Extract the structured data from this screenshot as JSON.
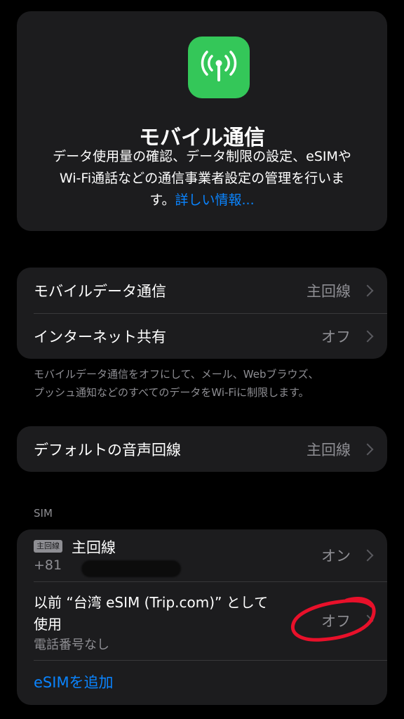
{
  "header": {
    "icon": "antenna-icon",
    "icon_color": "#34c759",
    "title": "モバイル通信",
    "description_line1": "データ使用量の確認、データ制限の設定、eSIMや",
    "description_line2": "Wi-Fi通話などの通信事業者設定の管理を行いま",
    "description_line3": "す。",
    "link": "詳しい情報..."
  },
  "settings": {
    "mobile_data": {
      "label": "モバイルデータ通信",
      "value": "主回線"
    },
    "hotspot": {
      "label": "インターネット共有",
      "value": "オフ"
    },
    "note_line1": "モバイルデータ通信をオフにして、メール、Webブラウズ、",
    "note_line2": "プッシュ通知などのすべてのデータをWi-Fiに制限します。",
    "default_voice": {
      "label": "デフォルトの音声回線",
      "value": "主回線"
    }
  },
  "sim": {
    "section_label": "SIM",
    "primary": {
      "badge": "主回線",
      "name": "主回線",
      "number_prefix": "+81",
      "value": "オン"
    },
    "previous": {
      "line1": "以前 “台湾 eSIM (Trip.com)” として",
      "line2": "使用",
      "sub": "電話番号なし",
      "value": "オフ"
    },
    "add_esim": "eSIMを追加"
  },
  "colors": {
    "accent": "#0a84ff",
    "annotation": "#e8102a"
  }
}
